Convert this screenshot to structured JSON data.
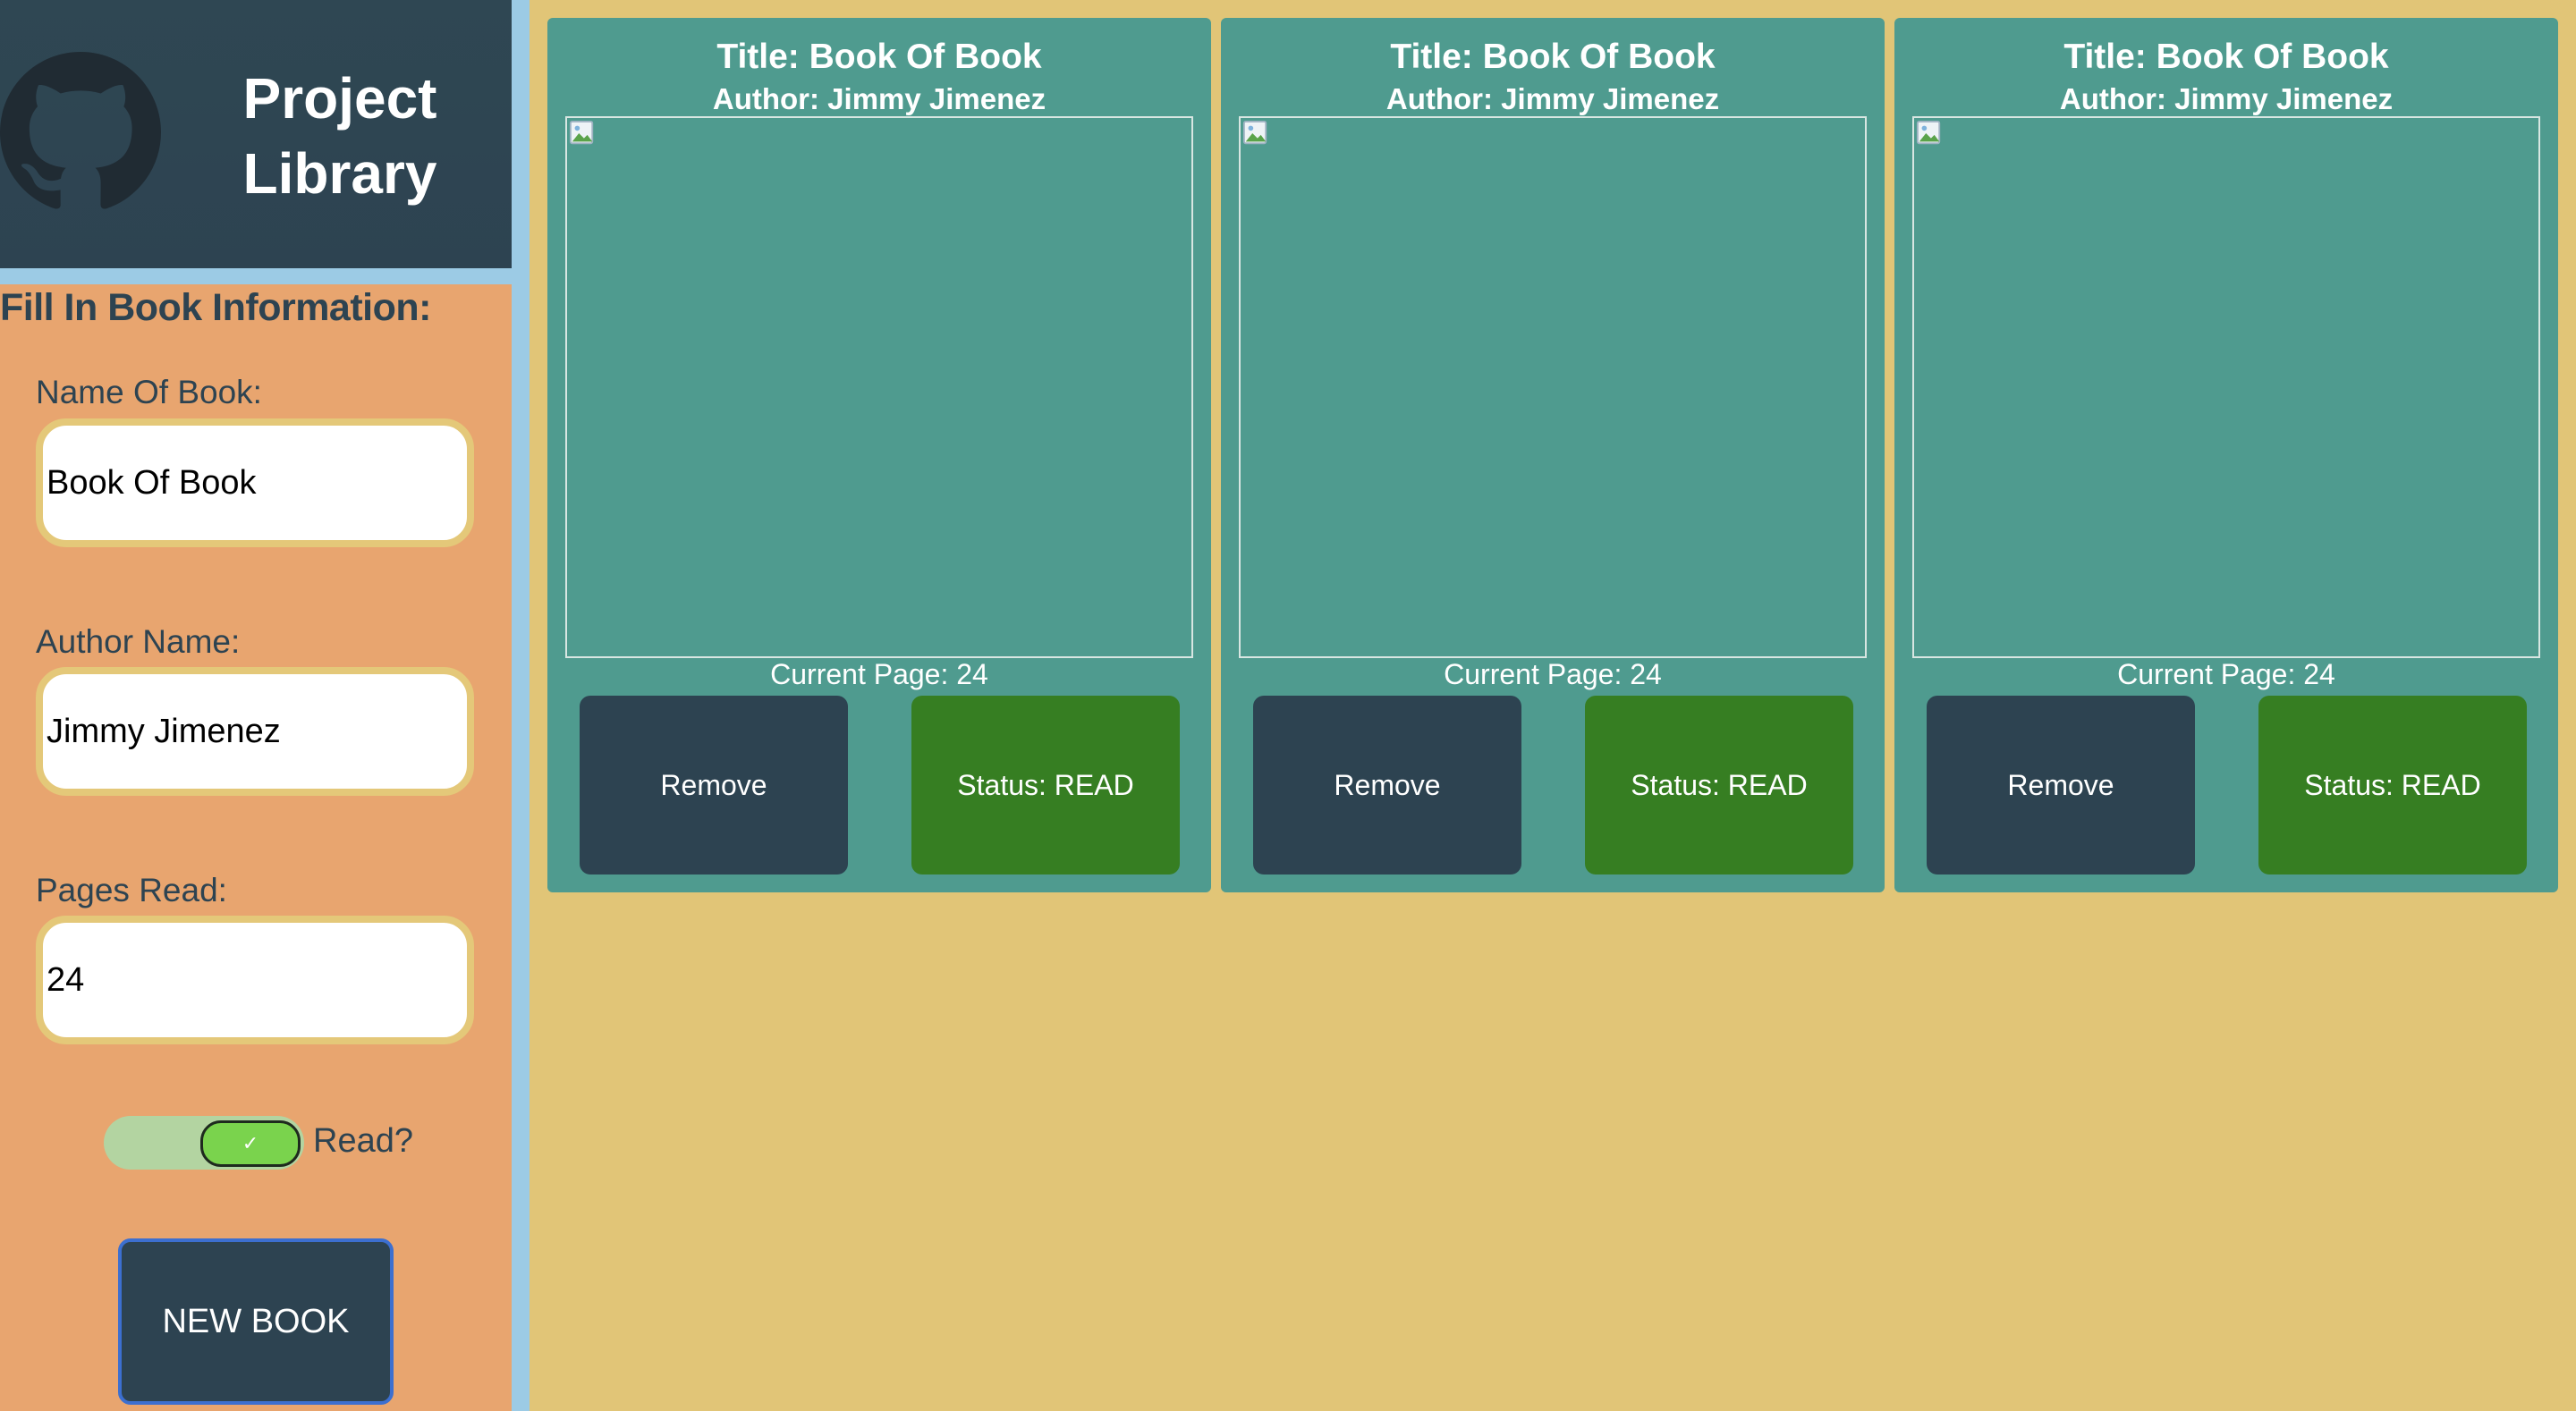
{
  "header": {
    "logo_icon": "github-icon",
    "title": "Project\nLibrary"
  },
  "form": {
    "heading": "Fill In Book Information:",
    "name_label": "Name Of Book:",
    "name_value": "Book Of Book",
    "author_label": "Author Name:",
    "author_value": "Jimmy Jimenez",
    "pages_label": "Pages Read:",
    "pages_value": "24",
    "read_toggle": {
      "checked": true,
      "check_glyph": "✓",
      "label": "Read?"
    },
    "submit_label": "NEW BOOK"
  },
  "books": [
    {
      "title": "Title: Book Of Book",
      "author": "Author: Jimmy Jimenez",
      "current_page": "Current Page: 24",
      "remove_label": "Remove",
      "status_label": "Status: READ"
    },
    {
      "title": "Title: Book Of Book",
      "author": "Author: Jimmy Jimenez",
      "current_page": "Current Page: 24",
      "remove_label": "Remove",
      "status_label": "Status: READ"
    },
    {
      "title": "Title: Book Of Book",
      "author": "Author: Jimmy Jimenez",
      "current_page": "Current Page: 24",
      "remove_label": "Remove",
      "status_label": "Status: READ"
    }
  ],
  "colors": {
    "page_background": "#e1c577",
    "sidebar_background": "#e8a56f",
    "header_background": "#2d4351",
    "card_background": "#4f9b8f",
    "status_button": "#367e22",
    "remove_button": "#2d4351"
  }
}
